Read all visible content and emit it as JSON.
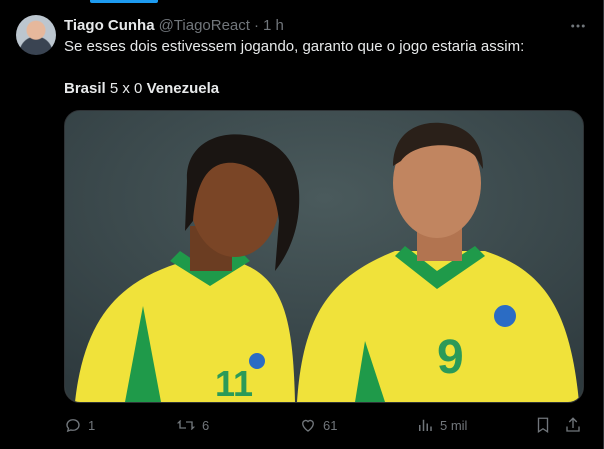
{
  "tweet": {
    "author_name": "Tiago Cunha",
    "handle": "@TiagoReact",
    "separator": "·",
    "time": "1 h",
    "text": "Se esses dois estivessem jogando, garanto que o jogo estaria assim:",
    "score": {
      "team_a": "Brasil",
      "score_text": "5 x 0",
      "team_b": "Venezuela"
    }
  },
  "media": {
    "shirt_numbers": {
      "left": "11",
      "right": "9"
    }
  },
  "actions": {
    "replies": "1",
    "reposts": "6",
    "likes": "61",
    "views": "5 mil"
  },
  "colors": {
    "accent": "#1d9bf0",
    "text_primary": "#e7e9ea",
    "text_secondary": "#71767b",
    "jersey_yellow": "#f0e23a",
    "jersey_green": "#1f9a4a"
  },
  "icons": [
    "more-icon",
    "reply-icon",
    "repost-icon",
    "like-icon",
    "views-icon",
    "bookmark-icon",
    "share-icon"
  ]
}
